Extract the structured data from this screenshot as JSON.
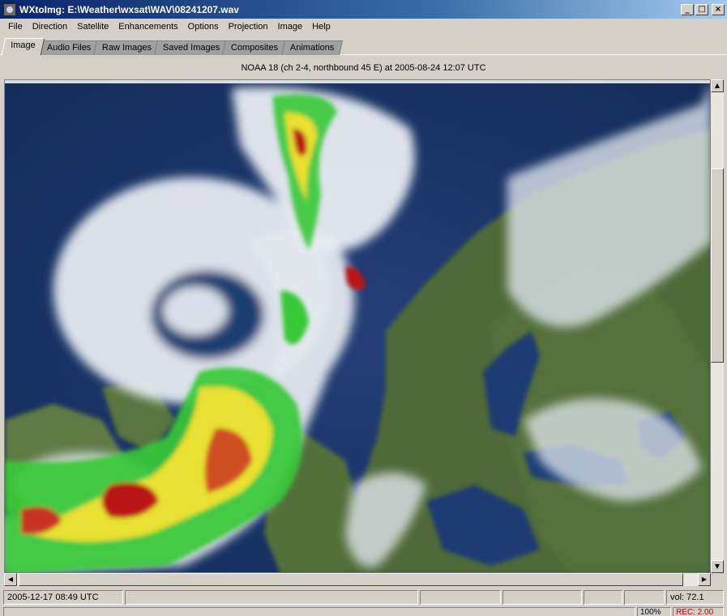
{
  "window": {
    "title": "WXtoImg: E:\\Weather\\wxsat\\WAV\\08241207.wav",
    "minimize_symbol": "_",
    "maximize_symbol": "□",
    "close_symbol": "×"
  },
  "menu": {
    "items": [
      "File",
      "Direction",
      "Satellite",
      "Enhancements",
      "Options",
      "Projection",
      "Image",
      "Help"
    ]
  },
  "tabs": {
    "items": [
      "Image",
      "Audio Files",
      "Raw Images",
      "Saved Images",
      "Composites",
      "Animations"
    ],
    "active": "Image"
  },
  "image": {
    "caption": "NOAA 18 (ch 2-4, northbound 45 E) at 2005-08-24  12:07 UTC"
  },
  "status": {
    "datetime": "2005-12-17  08:49 UTC",
    "volume": "vol: 72.1",
    "zoom": "100%",
    "rec": "REC: 2.00"
  },
  "colors": {
    "ocean": "#1b3b6e",
    "land": "#4e6a38",
    "cloud": "#e8ecf2",
    "rain_green": "#38c838",
    "rain_yellow": "#e8e030",
    "rain_red": "#b81818"
  },
  "icons": {
    "scroll_up": "▲",
    "scroll_down": "▼",
    "scroll_left": "◀",
    "scroll_right": "▶"
  }
}
